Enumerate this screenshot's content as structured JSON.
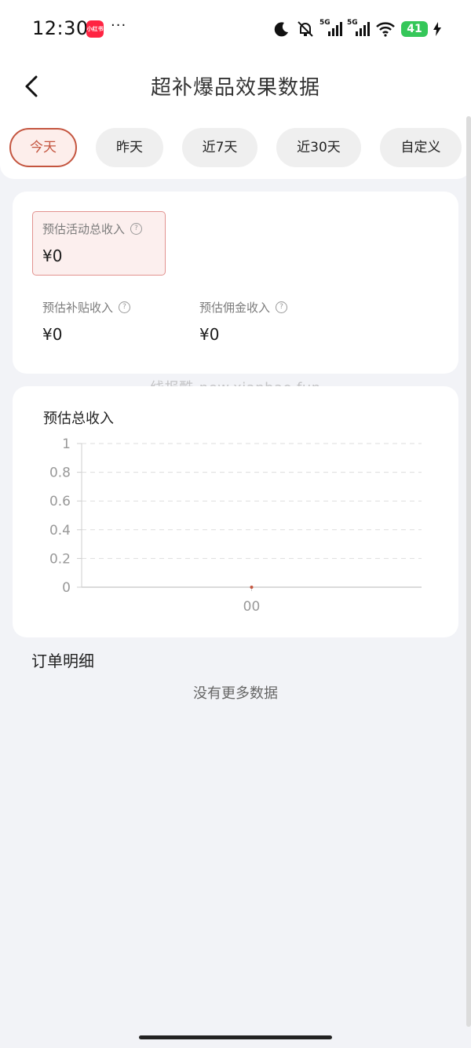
{
  "status_bar": {
    "time": "12:30",
    "app_badge": "小红书",
    "more": "···",
    "net1": "5G",
    "net2": "5G",
    "battery": "41"
  },
  "header": {
    "title": "超补爆品效果数据",
    "back_icon": "chevron-left-icon"
  },
  "tabs": [
    {
      "label": "今天",
      "active": true
    },
    {
      "label": "昨天",
      "active": false
    },
    {
      "label": "近7天",
      "active": false
    },
    {
      "label": "近30天",
      "active": false
    },
    {
      "label": "自定义",
      "active": false
    }
  ],
  "summary": {
    "total_label": "预估活动总收入",
    "total_value": "¥0",
    "subsidy_label": "预估补贴收入",
    "subsidy_value": "¥0",
    "commission_label": "预估佣金收入",
    "commission_value": "¥0",
    "help_icon": "question-circle-icon"
  },
  "watermark": "线报酷-new.xianbao.fun",
  "chart": {
    "title": "预估总收入"
  },
  "chart_data": {
    "type": "line",
    "title": "预估总收入",
    "x": [
      "00"
    ],
    "series": [
      {
        "values": [
          0
        ]
      }
    ],
    "ylim": [
      0,
      1
    ],
    "yticks": [
      "0",
      "0.2",
      "0.4",
      "0.6",
      "0.8",
      "1"
    ],
    "grid": true,
    "point_color": "#c4553f"
  },
  "orders": {
    "title": "订单明细",
    "empty": "没有更多数据"
  },
  "colors": {
    "accent": "#c4553f",
    "background": "#f2f3f7"
  }
}
